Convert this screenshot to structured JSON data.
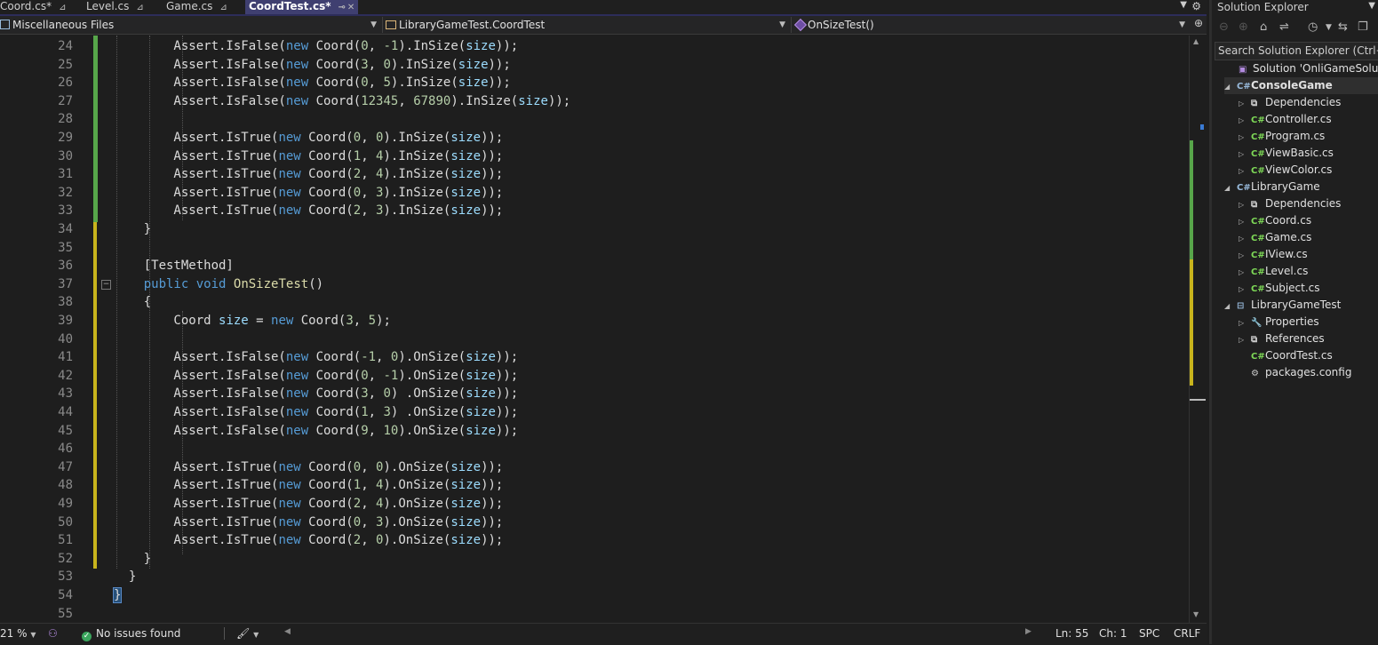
{
  "tabs": [
    {
      "label": "Coord.cs*",
      "active": false
    },
    {
      "label": "Level.cs",
      "active": false
    },
    {
      "label": "Game.cs",
      "active": false
    },
    {
      "label": "CoordTest.cs*",
      "active": true
    }
  ],
  "nav": {
    "project": "Miscellaneous Files",
    "class": "LibraryGameTest.CoordTest",
    "member": "OnSizeTest()"
  },
  "code_lines": [
    {
      "n": "24",
      "html": "        Assert.IsFalse(<span class='kw'>new</span> Coord(<span class='num'>0</span>, <span class='num'>-1</span>).InSize(<span class='id'>size</span>));"
    },
    {
      "n": "25",
      "html": "        Assert.IsFalse(<span class='kw'>new</span> Coord(<span class='num'>3</span>, <span class='num'>0</span>).InSize(<span class='id'>size</span>));"
    },
    {
      "n": "26",
      "html": "        Assert.IsFalse(<span class='kw'>new</span> Coord(<span class='num'>0</span>, <span class='num'>5</span>).InSize(<span class='id'>size</span>));"
    },
    {
      "n": "27",
      "html": "        Assert.IsFalse(<span class='kw'>new</span> Coord(<span class='num'>12345</span>, <span class='num'>67890</span>).InSize(<span class='id'>size</span>));"
    },
    {
      "n": "28",
      "html": ""
    },
    {
      "n": "29",
      "html": "        Assert.IsTrue(<span class='kw'>new</span> Coord(<span class='num'>0</span>, <span class='num'>0</span>).InSize(<span class='id'>size</span>));"
    },
    {
      "n": "30",
      "html": "        Assert.IsTrue(<span class='kw'>new</span> Coord(<span class='num'>1</span>, <span class='num'>4</span>).InSize(<span class='id'>size</span>));"
    },
    {
      "n": "31",
      "html": "        Assert.IsTrue(<span class='kw'>new</span> Coord(<span class='num'>2</span>, <span class='num'>4</span>).InSize(<span class='id'>size</span>));"
    },
    {
      "n": "32",
      "html": "        Assert.IsTrue(<span class='kw'>new</span> Coord(<span class='num'>0</span>, <span class='num'>3</span>).InSize(<span class='id'>size</span>));"
    },
    {
      "n": "33",
      "html": "        Assert.IsTrue(<span class='kw'>new</span> Coord(<span class='num'>2</span>, <span class='num'>3</span>).InSize(<span class='id'>size</span>));"
    },
    {
      "n": "34",
      "html": "    }"
    },
    {
      "n": "35",
      "html": ""
    },
    {
      "n": "36",
      "html": "    [TestMethod]"
    },
    {
      "n": "37",
      "html": "    <span class='kw'>public</span> <span class='kw'>void</span> <span class='mt'>OnSizeTest</span>()"
    },
    {
      "n": "38",
      "html": "    {"
    },
    {
      "n": "39",
      "html": "        Coord <span class='id'>size</span> = <span class='kw'>new</span> Coord(<span class='num'>3</span>, <span class='num'>5</span>);"
    },
    {
      "n": "40",
      "html": ""
    },
    {
      "n": "41",
      "html": "        Assert.IsFalse(<span class='kw'>new</span> Coord(<span class='num'>-1</span>, <span class='num'>0</span>).OnSize(<span class='id'>size</span>));"
    },
    {
      "n": "42",
      "html": "        Assert.IsFalse(<span class='kw'>new</span> Coord(<span class='num'>0</span>, <span class='num'>-1</span>).OnSize(<span class='id'>size</span>));"
    },
    {
      "n": "43",
      "html": "        Assert.IsFalse(<span class='kw'>new</span> Coord(<span class='num'>3</span>, <span class='num'>0</span>) .OnSize(<span class='id'>size</span>));"
    },
    {
      "n": "44",
      "html": "        Assert.IsFalse(<span class='kw'>new</span> Coord(<span class='num'>1</span>, <span class='num'>3</span>) .OnSize(<span class='id'>size</span>));"
    },
    {
      "n": "45",
      "html": "        Assert.IsFalse(<span class='kw'>new</span> Coord(<span class='num'>9</span>, <span class='num'>10</span>).OnSize(<span class='id'>size</span>));"
    },
    {
      "n": "46",
      "html": ""
    },
    {
      "n": "47",
      "html": "        Assert.IsTrue(<span class='kw'>new</span> Coord(<span class='num'>0</span>, <span class='num'>0</span>).OnSize(<span class='id'>size</span>));"
    },
    {
      "n": "48",
      "html": "        Assert.IsTrue(<span class='kw'>new</span> Coord(<span class='num'>1</span>, <span class='num'>4</span>).OnSize(<span class='id'>size</span>));"
    },
    {
      "n": "49",
      "html": "        Assert.IsTrue(<span class='kw'>new</span> Coord(<span class='num'>2</span>, <span class='num'>4</span>).OnSize(<span class='id'>size</span>));"
    },
    {
      "n": "50",
      "html": "        Assert.IsTrue(<span class='kw'>new</span> Coord(<span class='num'>0</span>, <span class='num'>3</span>).OnSize(<span class='id'>size</span>));"
    },
    {
      "n": "51",
      "html": "        Assert.IsTrue(<span class='kw'>new</span> Coord(<span class='num'>2</span>, <span class='num'>0</span>).OnSize(<span class='id'>size</span>));"
    },
    {
      "n": "52",
      "html": "    }"
    },
    {
      "n": "53",
      "html": "  }"
    },
    {
      "n": "54",
      "html": "<span class='brace-hl'>}</span>"
    },
    {
      "n": "55",
      "html": ""
    }
  ],
  "status": {
    "zoom": "21 %",
    "issues": "No issues found",
    "line": "Ln: 55",
    "col": "Ch: 1",
    "whitespace": "SPC",
    "eol": "CRLF"
  },
  "solution_explorer": {
    "title": "Solution Explorer",
    "search_placeholder": "Search Solution Explorer (Ctrl+ж)",
    "tree": [
      {
        "label": "Solution 'OnliGameSolution'",
        "level": 0,
        "icon": "solution-icon",
        "exp": ""
      },
      {
        "label": "ConsoleGame",
        "level": 0,
        "icon": "project-icon",
        "exp": "◢",
        "bold": true,
        "selected": true
      },
      {
        "label": "Dependencies",
        "level": 1,
        "icon": "dependencies-icon",
        "exp": "▷"
      },
      {
        "label": "Controller.cs",
        "level": 1,
        "icon": "csharp-file-icon",
        "exp": "▷"
      },
      {
        "label": "Program.cs",
        "level": 1,
        "icon": "csharp-file-icon",
        "exp": "▷"
      },
      {
        "label": "ViewBasic.cs",
        "level": 1,
        "icon": "csharp-file-icon",
        "exp": "▷"
      },
      {
        "label": "ViewColor.cs",
        "level": 1,
        "icon": "csharp-file-icon",
        "exp": "▷"
      },
      {
        "label": "LibraryGame",
        "level": 0,
        "icon": "project-icon",
        "exp": "◢"
      },
      {
        "label": "Dependencies",
        "level": 1,
        "icon": "dependencies-icon",
        "exp": "▷"
      },
      {
        "label": "Coord.cs",
        "level": 1,
        "icon": "csharp-file-icon",
        "exp": "▷"
      },
      {
        "label": "Game.cs",
        "level": 1,
        "icon": "csharp-file-icon",
        "exp": "▷"
      },
      {
        "label": "IView.cs",
        "level": 1,
        "icon": "csharp-file-icon",
        "exp": "▷"
      },
      {
        "label": "Level.cs",
        "level": 1,
        "icon": "csharp-file-icon",
        "exp": "▷"
      },
      {
        "label": "Subject.cs",
        "level": 1,
        "icon": "csharp-file-icon",
        "exp": "▷"
      },
      {
        "label": "LibraryGameTest",
        "level": 0,
        "icon": "test-project-icon",
        "exp": "◢"
      },
      {
        "label": "Properties",
        "level": 1,
        "icon": "wrench-icon",
        "exp": "▷"
      },
      {
        "label": "References",
        "level": 1,
        "icon": "dependencies-icon",
        "exp": "▷"
      },
      {
        "label": "CoordTest.cs",
        "level": 1,
        "icon": "csharp-file-icon",
        "exp": ""
      },
      {
        "label": "packages.config",
        "level": 1,
        "icon": "config-file-icon",
        "exp": ""
      }
    ]
  }
}
